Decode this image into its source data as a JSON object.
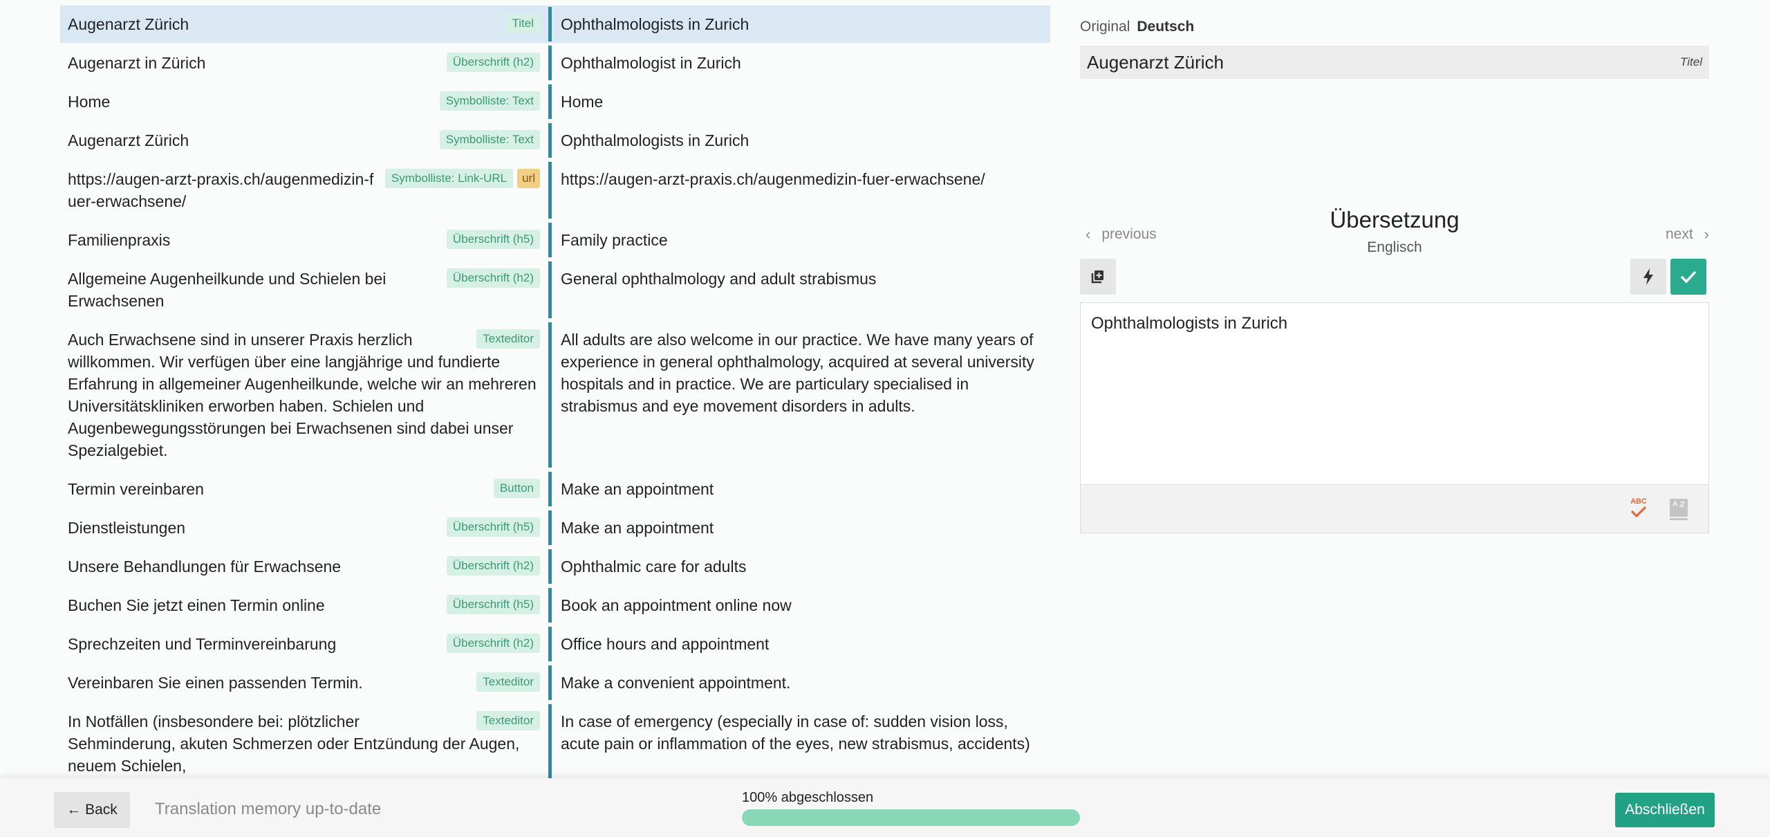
{
  "segments": [
    {
      "source": "Augenarzt Zürich",
      "tags": [
        "Titel"
      ],
      "target": "Ophthalmologists in Zurich",
      "selected": true
    },
    {
      "source": "Augenarzt in Zürich",
      "tags": [
        "Überschrift (h2)"
      ],
      "target": "Ophthalmologist in Zurich"
    },
    {
      "source": "Home",
      "tags": [
        "Symbolliste: Text"
      ],
      "target": "Home"
    },
    {
      "source": "Augenarzt Zürich",
      "tags": [
        "Symbolliste: Text"
      ],
      "target": "Ophthalmologists in Zurich"
    },
    {
      "source": "https://augen-arzt-praxis.ch/augenmedizin-fuer-erwachsene/",
      "tags": [
        "Symbolliste: Link-URL",
        "url"
      ],
      "target": "https://augen-arzt-praxis.ch/augenmedizin-fuer-erwachsene/"
    },
    {
      "source": "Familienpraxis",
      "tags": [
        "Überschrift (h5)"
      ],
      "target": "Family practice"
    },
    {
      "source": "Allgemeine Augenheilkunde und Schielen bei Erwachsenen",
      "tags": [
        "Überschrift (h2)"
      ],
      "target": "General ophthalmology and adult strabismus"
    },
    {
      "source": "Auch Erwachsene sind in unserer Praxis herzlich willkommen. Wir verfügen über eine langjährige und fundierte Erfahrung in allgemeiner Augenheilkunde, welche wir an mehreren Universitätskliniken erworben haben. Schielen und Augenbewegungsstörungen bei Erwachsenen sind dabei unser Spezialgebiet.",
      "tags": [
        "Texteditor"
      ],
      "target": "All adults are also welcome in our practice. We have many years of experience in general ophthalmology, acquired at several university hospitals and in practice. We are particulary specialised in strabismus and eye movement disorders in adults."
    },
    {
      "source": "Termin vereinbaren",
      "tags": [
        "Button"
      ],
      "target": "Make an appointment"
    },
    {
      "source": "Dienstleistungen",
      "tags": [
        "Überschrift (h5)"
      ],
      "target": "Make an appointment"
    },
    {
      "source": "Unsere Behandlungen für Erwachsene",
      "tags": [
        "Überschrift (h2)"
      ],
      "target": "Ophthalmic care for adults"
    },
    {
      "source": "Buchen Sie jetzt einen Termin online",
      "tags": [
        "Überschrift (h5)"
      ],
      "target": "Book an appointment online now"
    },
    {
      "source": "Sprechzeiten und Terminvereinbarung",
      "tags": [
        "Überschrift (h2)"
      ],
      "target": "Office hours and appointment"
    },
    {
      "source": "Vereinbaren Sie einen passenden Termin.",
      "tags": [
        "Texteditor"
      ],
      "target": "Make a convenient appointment."
    },
    {
      "source": "In Notfällen (insbesondere bei: plötzlicher Sehminderung, akuten Schmerzen oder Entzündung der Augen, neuem Schielen,",
      "tags": [
        "Texteditor"
      ],
      "target": "In case of emergency (especially in case of: sudden vision loss, acute pain or inflammation of the eyes, new strabismus, accidents)"
    }
  ],
  "original": {
    "label": "Original",
    "language": "Deutsch",
    "text": "Augenarzt Zürich",
    "field_label": "Titel"
  },
  "translation": {
    "title": "Übersetzung",
    "language": "Englisch",
    "previous": "previous",
    "next": "next",
    "text": "Ophthalmologists in Zurich",
    "spellcheck_icon_text": "ABC"
  },
  "footer": {
    "back": "← Back",
    "tm_status": "Translation memory up-to-date",
    "progress_label": "100% abgeschlossen",
    "progress_fraction": 1.0,
    "finish": "Abschließen"
  },
  "colors": {
    "accent": "#23a184",
    "separator": "#2e8aa1",
    "selected_row": "#d9e8f3",
    "tag_bg": "#d7f0e6",
    "url_tag_bg": "#f3cf86"
  }
}
